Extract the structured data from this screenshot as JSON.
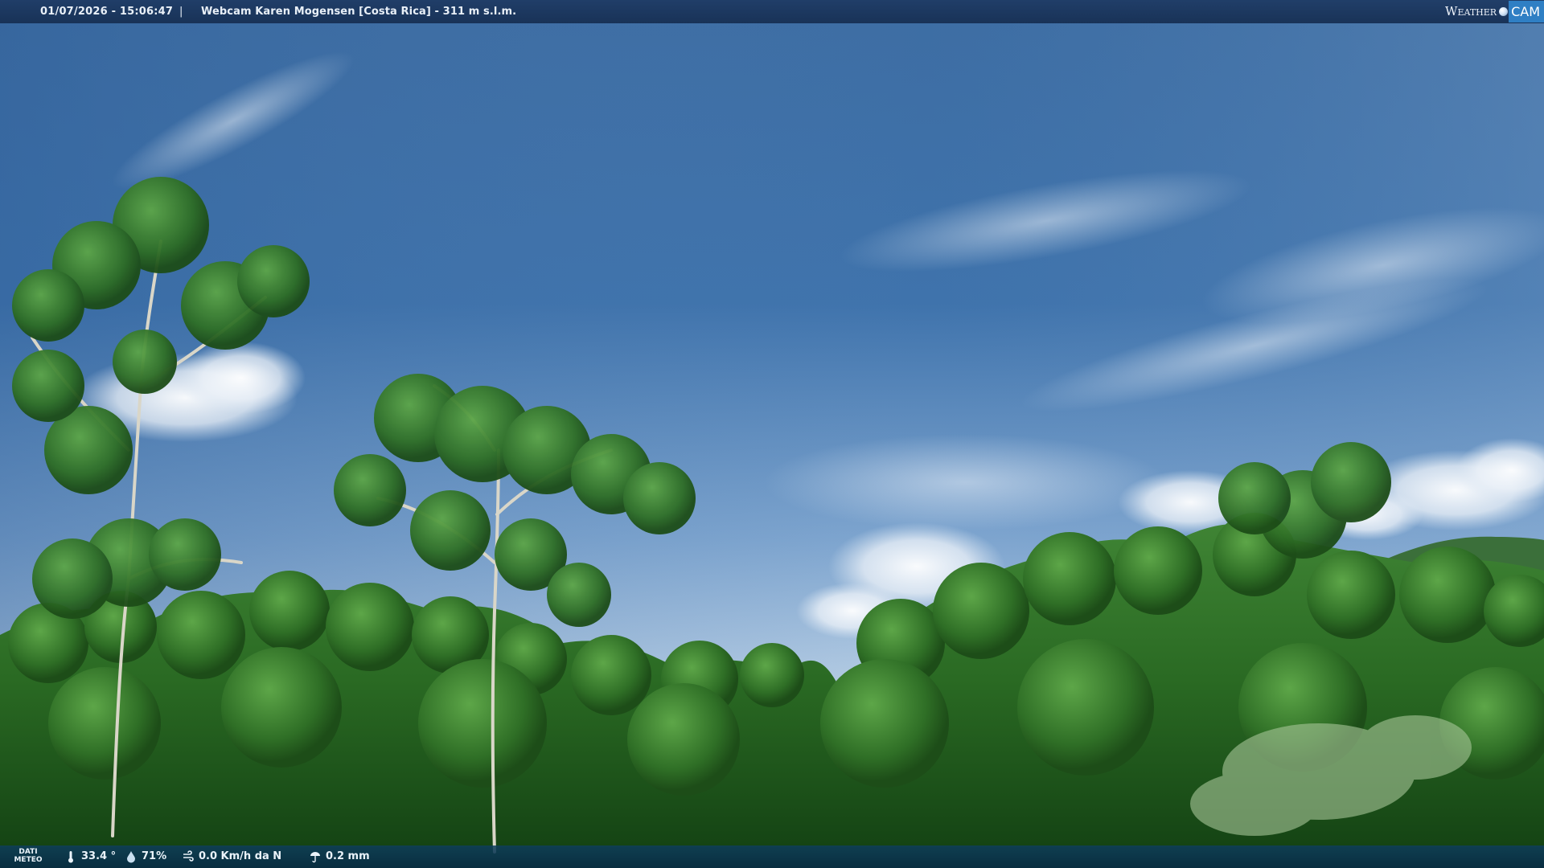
{
  "header": {
    "datetime": "01/07/2026 - 15:06:47",
    "separator": "|",
    "title": "Webcam Karen Mogensen [Costa Rica]  - 311 m s.l.m."
  },
  "logo": {
    "part1": "Weather",
    "part2": "CAM"
  },
  "weather": {
    "label_line1": "DATI",
    "label_line2": "METEO",
    "temperature": "33.4 °",
    "humidity": "71%",
    "wind": "0.0 Km/h da N",
    "rain": "0.2 mm"
  },
  "icons": {
    "temperature": "thermometer-icon",
    "humidity": "humidity-icon",
    "wind": "wind-icon",
    "rain": "rain-gauge-icon"
  },
  "colors": {
    "sky_top": "#2e5f96",
    "sky_bottom": "#a9c6e2",
    "foliage": "#1f5a1f",
    "bar": "#1c3a64",
    "logo_accent": "#2f7fc4"
  }
}
